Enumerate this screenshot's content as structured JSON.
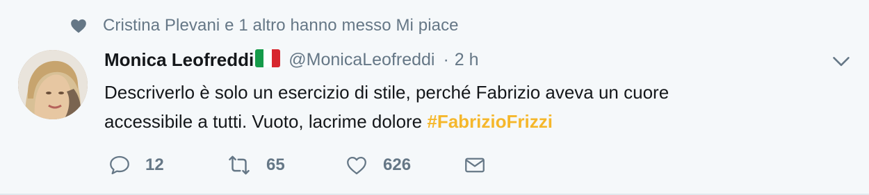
{
  "social_context": {
    "icon": "heart-icon",
    "text": "Cristina Plevani e 1 altro hanno messo Mi piace"
  },
  "author": {
    "name": "Monica Leofreddi",
    "flag": "italy-flag-icon",
    "handle": "@MonicaLeofreddi",
    "separator": "·",
    "time": "2 h"
  },
  "tweet": {
    "text_line1": "Descriverlo è solo un esercizio di stile, perché Fabrizio aveva un cuore",
    "text_line2": "accessibile a tutti. Vuoto, lacrime dolore ",
    "hashtag": "#FabrizioFrizzi"
  },
  "actions": {
    "reply_count": "12",
    "retweet_count": "65",
    "like_count": "626"
  },
  "colors": {
    "background": "#f5f8fa",
    "secondary_text": "#657786",
    "primary_text": "#14171a",
    "hashtag": "#f5b72b"
  }
}
